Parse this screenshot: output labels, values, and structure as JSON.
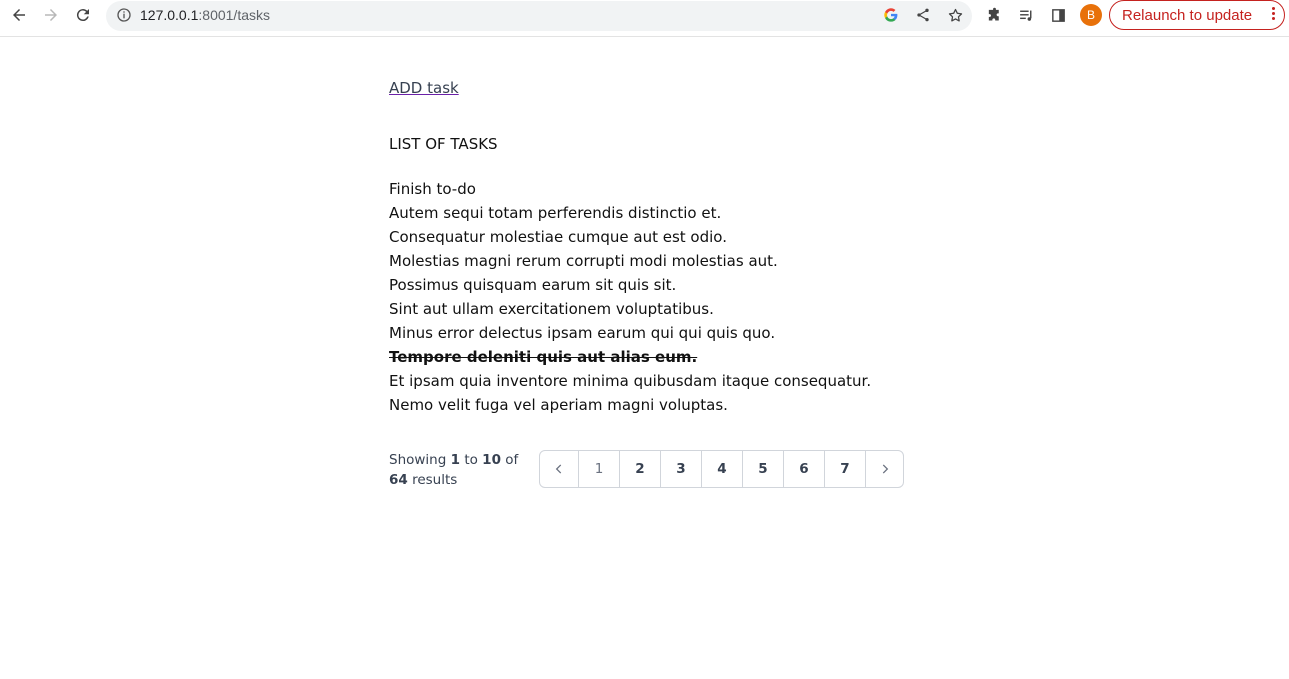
{
  "browser": {
    "url_host": "127.0.0.1",
    "url_rest": ":8001/tasks",
    "avatar_letter": "B",
    "relaunch_label": "Relaunch to update"
  },
  "page": {
    "add_link": "ADD task",
    "list_heading": "LIST OF TASKS",
    "tasks": [
      {
        "text": "Finish to-do",
        "completed": false
      },
      {
        "text": "Autem sequi totam perferendis distinctio et.",
        "completed": false
      },
      {
        "text": "Consequatur molestiae cumque aut est odio.",
        "completed": false
      },
      {
        "text": "Molestias magni rerum corrupti modi molestias aut.",
        "completed": false
      },
      {
        "text": "Possimus quisquam earum sit quis sit.",
        "completed": false
      },
      {
        "text": "Sint aut ullam exercitationem voluptatibus.",
        "completed": false
      },
      {
        "text": "Minus error delectus ipsam earum qui qui quis quo.",
        "completed": false
      },
      {
        "text": "Tempore deleniti quis aut alias eum.",
        "completed": true
      },
      {
        "text": "Et ipsam quia inventore minima quibusdam itaque consequatur.",
        "completed": false
      },
      {
        "text": "Nemo velit fuga vel aperiam magni voluptas.",
        "completed": false
      }
    ]
  },
  "pagination": {
    "showing_word": "Showing",
    "from": "1",
    "to_word": "to",
    "to": "10",
    "of_word": "of",
    "total": "64",
    "results_word": "results",
    "pages": [
      "1",
      "2",
      "3",
      "4",
      "5",
      "6",
      "7"
    ],
    "current_page": "1"
  },
  "colors": {
    "relaunch": "#c5221f",
    "avatar": "#e8710a",
    "link_underline": "#6b21a8"
  }
}
